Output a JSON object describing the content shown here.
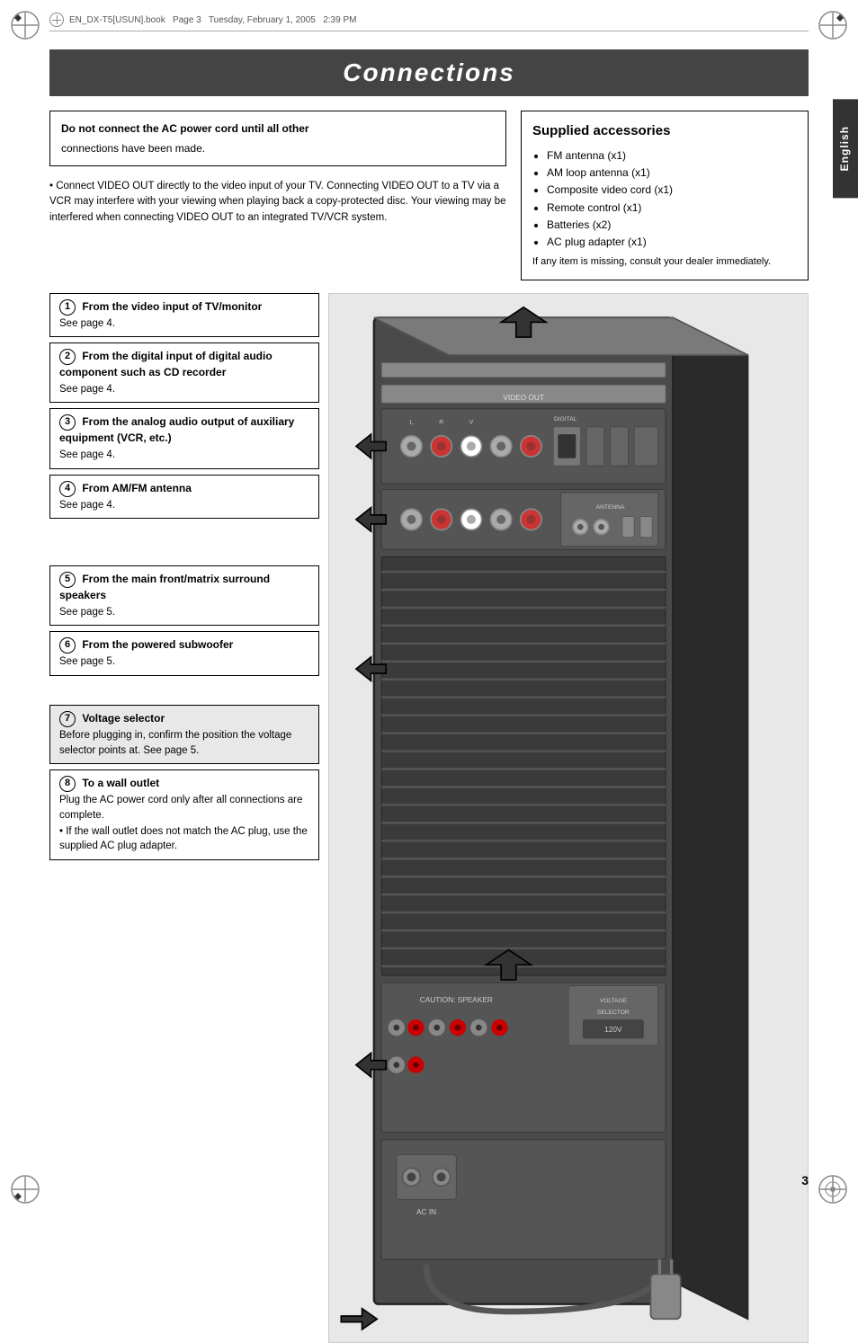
{
  "meta": {
    "filename": "EN_DX-T5[USUN].book",
    "page": "Page 3",
    "date": "Tuesday, February 1, 2005",
    "time": "2:39 PM"
  },
  "page_title": "Connections",
  "language_tab": "English",
  "page_number": "3",
  "warning": {
    "line1": "Do not connect the AC power cord until all other",
    "line2": "connections have been made."
  },
  "intro_text": "• Connect VIDEO OUT directly to the video input of your TV. Connecting VIDEO OUT to a TV via a VCR may interfere with your viewing when playing back a copy-protected disc. Your viewing may be interfered when connecting VIDEO OUT to an integrated TV/VCR system.",
  "accessories": {
    "title": "Supplied accessories",
    "items": [
      "FM antenna (x1)",
      "AM loop antenna (x1)",
      "Composite video cord (x1)",
      "Remote control (x1)",
      "Batteries (x2)",
      "AC plug adapter (x1)"
    ],
    "note": "If any item is missing, consult your dealer immediately."
  },
  "callouts": [
    {
      "number": "1",
      "title": "From the video input of TV/monitor",
      "see_page": "See page 4."
    },
    {
      "number": "2",
      "title": "From the digital input of digital audio component such as CD recorder",
      "see_page": "See page 4."
    },
    {
      "number": "3",
      "title": "From the analog audio output of auxiliary equipment (VCR, etc.)",
      "see_page": "See page 4."
    },
    {
      "number": "4",
      "title": "From AM/FM antenna",
      "see_page": "See page 4."
    },
    {
      "number": "5",
      "title": "From the main front/matrix surround speakers",
      "see_page": "See page 5."
    },
    {
      "number": "6",
      "title": "From the powered subwoofer",
      "see_page": "See page 5."
    },
    {
      "number": "7",
      "title": "Voltage selector",
      "detail": "Before plugging in, confirm the position the voltage selector points at. See page 5.",
      "is_voltage": true
    },
    {
      "number": "8",
      "title": "To a wall outlet",
      "detail1": "Plug the AC power cord only after all connections are complete.",
      "detail2": "• If the wall outlet does not match the AC plug, use the supplied AC plug adapter."
    }
  ]
}
